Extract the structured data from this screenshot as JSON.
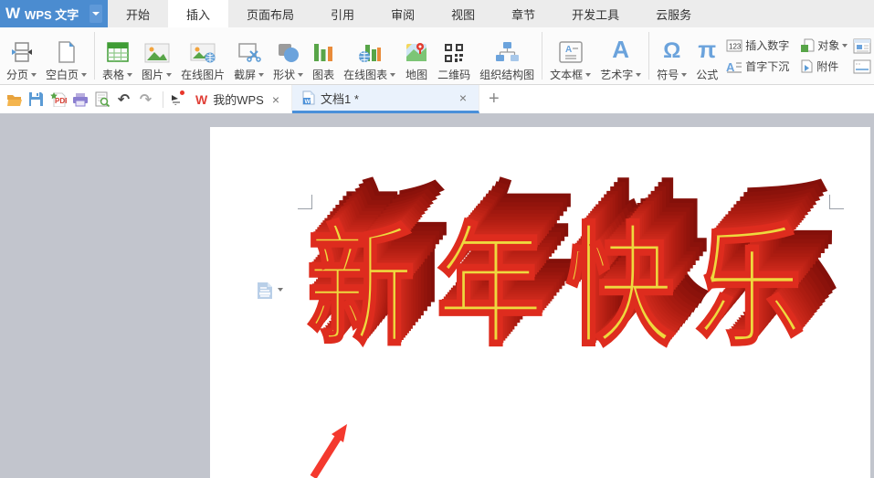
{
  "app": {
    "logo_w": "W",
    "logo_title": "WPS 文字"
  },
  "menu": {
    "tabs": [
      {
        "label": "开始",
        "active": false
      },
      {
        "label": "插入",
        "active": true
      },
      {
        "label": "页面布局",
        "active": false
      },
      {
        "label": "引用",
        "active": false
      },
      {
        "label": "审阅",
        "active": false
      },
      {
        "label": "视图",
        "active": false
      },
      {
        "label": "章节",
        "active": false
      },
      {
        "label": "开发工具",
        "active": false
      },
      {
        "label": "云服务",
        "active": false
      }
    ]
  },
  "ribbon": {
    "page_break": "分页",
    "blank_page": "空白页",
    "table": "表格",
    "picture": "图片",
    "online_picture": "在线图片",
    "screenshot": "截屏",
    "shapes": "形状",
    "chart": "图表",
    "online_chart": "在线图表",
    "map": "地图",
    "qr_code": "二维码",
    "org_chart": "组织结构图",
    "text_box": "文本框",
    "word_art": "艺术字",
    "symbol": "符号",
    "formula": "公式",
    "insert_number": "插入数字",
    "object": "对象",
    "drop_cap": "首字下沉",
    "attachment": "附件"
  },
  "icons": {
    "omega": "Ω",
    "pi": "π",
    "num123": "123",
    "letter_a": "A",
    "undo": "↶",
    "redo": "↷",
    "close": "×",
    "add": "+",
    "wps_w": "W"
  },
  "doc_tabs": {
    "my_wps": "我的WPS",
    "doc1": "文档1 *"
  },
  "document": {
    "wordart_text": "新年快乐"
  },
  "colors": {
    "accent": "#4a90d9",
    "wordart_yellow": "#eed93e",
    "wordart_outline": "#de2c1e",
    "wordart_depth": "#a61a10",
    "arrow_red": "#f4392e",
    "workspace_gray": "#c2c5cd"
  }
}
